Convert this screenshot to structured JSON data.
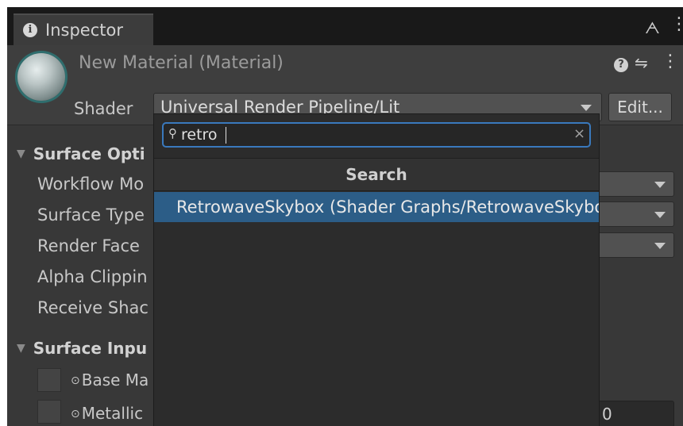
{
  "tab": {
    "label": "Inspector"
  },
  "header": {
    "title": "New Material (Material)",
    "shader_label": "Shader",
    "shader_value": "Universal Render Pipeline/Lit",
    "edit_label": "Edit..."
  },
  "sections": {
    "surface_options": "Surface Opti",
    "surface_inputs": "Surface Inpu"
  },
  "properties": {
    "workflow": "Workflow Mo",
    "surface_type": "Surface Type",
    "render_face": "Render Face",
    "alpha_clipping": "Alpha Clippin",
    "receive_shadows": "Receive Shac",
    "base_map": "Base Ma",
    "metallic": "Metallic",
    "metallic_value": "0"
  },
  "popup": {
    "search_value": "retro",
    "section_header": "Search",
    "results": [
      "RetrowaveSkybox (Shader Graphs/RetrowaveSkybox)"
    ]
  },
  "colors": {
    "accent": "#3a79bd",
    "selection": "#2c5d87",
    "panel": "#383838"
  }
}
